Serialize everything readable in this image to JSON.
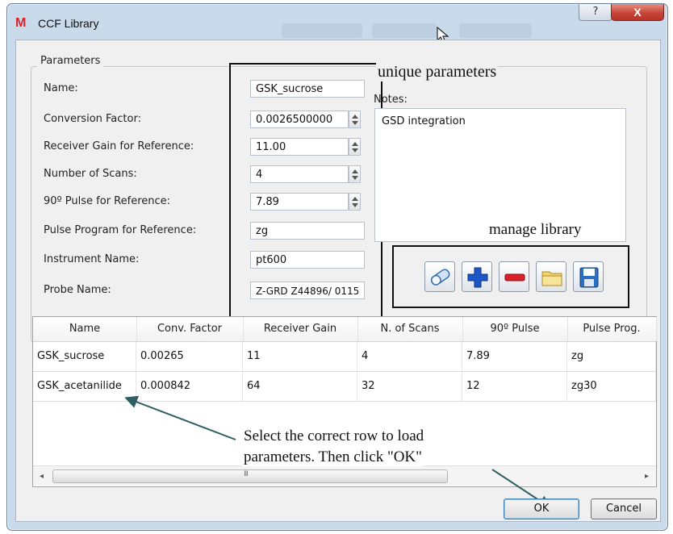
{
  "window": {
    "title": "CCF Library",
    "help_glyph": "?",
    "close_glyph": "X"
  },
  "parameters": {
    "group_title": "Parameters",
    "name_label": "Name:",
    "name_value": "GSK_sucrose",
    "conversion_label": "Conversion Factor:",
    "conversion_value": "0.0026500000",
    "gain_label": "Receiver Gain for Reference:",
    "gain_value": "11.00",
    "scans_label": "Number of Scans:",
    "scans_value": "4",
    "pulse_label": "90º Pulse for Reference:",
    "pulse_value": "7.89",
    "program_label": "Pulse Program for Reference:",
    "program_value": "zg",
    "instrument_label": "Instrument Name:",
    "instrument_value": "pt600",
    "probe_label": "Probe Name:",
    "probe_value": "Z-GRD Z44896/ 0115"
  },
  "notes": {
    "label": "Notes:",
    "text": "GSD integration"
  },
  "annotations": {
    "unique": "unique parameters",
    "manage": "manage library",
    "select_line1": "Select the correct row to load",
    "select_line2": "parameters. Then click \"OK\""
  },
  "toolbar": [
    "eraser-icon",
    "add-icon",
    "remove-icon",
    "folder-icon",
    "save-icon"
  ],
  "table": {
    "headers": [
      "Name",
      "Conv. Factor",
      "Receiver Gain",
      "N. of Scans",
      "90º Pulse",
      "Pulse Prog."
    ],
    "rows": [
      [
        "GSK_sucrose",
        "0.00265",
        "11",
        "4",
        "7.89",
        "zg"
      ],
      [
        "GSK_acetanilide",
        "0.000842",
        "64",
        "32",
        "12",
        "zg30"
      ]
    ],
    "scroll_left": "◂",
    "scroll_right": "▸",
    "scroll_grip": "III"
  },
  "buttons": {
    "ok": "OK",
    "cancel": "Cancel"
  },
  "colors": {
    "window_frame": "#c9daea",
    "close": "#c7463a",
    "accent": "#3c7fb1"
  }
}
